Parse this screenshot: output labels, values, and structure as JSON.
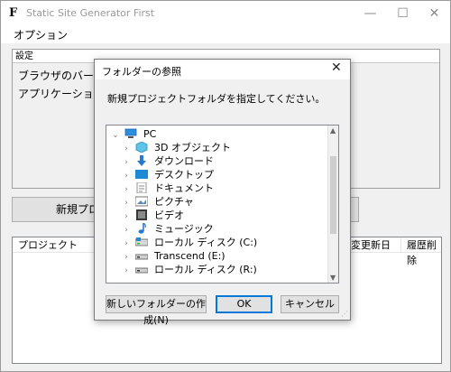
{
  "window": {
    "app_icon": "F",
    "title": "Static Site Generator First",
    "minimize": "—",
    "maximize": "☐",
    "close": "✕"
  },
  "menu": {
    "options": "オプション"
  },
  "settings": {
    "header": "設定",
    "line1": "ブラウザのバージョン",
    "line2": "アプリケーションが"
  },
  "new_project_button": "新規プロジ",
  "project_table": {
    "col_project": "プロジェクト",
    "col_updated": "変更新日",
    "col_delete": "履歴削除"
  },
  "dialog": {
    "title": "フォルダーの参照",
    "close": "✕",
    "description": "新規プロジェクトフォルダを指定してください。",
    "tree": [
      {
        "label": "PC",
        "icon": "pc-icon",
        "arrow": "expanded",
        "level": 0
      },
      {
        "label": "3D オブジェクト",
        "icon": "3d-objects-icon",
        "arrow": "collapsed",
        "level": 1
      },
      {
        "label": "ダウンロード",
        "icon": "download-icon",
        "arrow": "collapsed",
        "level": 1
      },
      {
        "label": "デスクトップ",
        "icon": "desktop-icon",
        "arrow": "collapsed",
        "level": 1
      },
      {
        "label": "ドキュメント",
        "icon": "document-icon",
        "arrow": "collapsed",
        "level": 1
      },
      {
        "label": "ピクチャ",
        "icon": "pictures-icon",
        "arrow": "collapsed",
        "level": 1
      },
      {
        "label": "ビデオ",
        "icon": "video-icon",
        "arrow": "collapsed",
        "level": 1
      },
      {
        "label": "ミュージック",
        "icon": "music-icon",
        "arrow": "collapsed",
        "level": 1
      },
      {
        "label": "ローカル ディスク (C:)",
        "icon": "local-disk-icon",
        "arrow": "collapsed",
        "level": 1
      },
      {
        "label": "Transcend (E:)",
        "icon": "drive-icon",
        "arrow": "collapsed",
        "level": 1
      },
      {
        "label": "ローカル ディスク (R:)",
        "icon": "drive-icon",
        "arrow": "collapsed",
        "level": 1
      }
    ],
    "new_folder_button": "新しいフォルダーの作成(N)",
    "ok_button": "OK",
    "cancel_button": "キャンセル"
  },
  "colors": {
    "accent": "#0078d7",
    "pc_blue": "#2b8fe0",
    "download_blue": "#2a78d0"
  }
}
